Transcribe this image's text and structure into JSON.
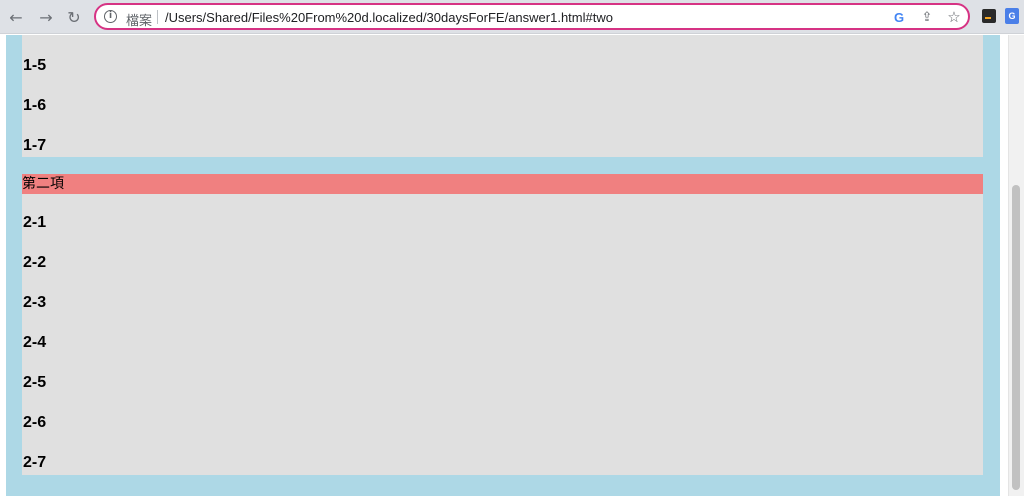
{
  "browser": {
    "back_icon": "←",
    "forward_icon": "→",
    "reload_icon": "↻",
    "info_icon": "i",
    "file_label": "檔案",
    "url": "/Users/Shared/Files%20From%20d.localized/30daysForFE/answer1.html#two",
    "google_icon": "G",
    "share_icon": "⇪",
    "star_icon": "☆",
    "translate_icon": "G",
    "accent_color": "#d63384"
  },
  "page": {
    "colors": {
      "outer_background": "#add8e6",
      "panel_background": "#e0e0e0",
      "header_background": "#f08080"
    },
    "section_one_items": [
      "1-5",
      "1-6",
      "1-7"
    ],
    "section_two": {
      "header": "第二項",
      "items": [
        "2-1",
        "2-2",
        "2-3",
        "2-4",
        "2-5",
        "2-6",
        "2-7"
      ]
    }
  }
}
